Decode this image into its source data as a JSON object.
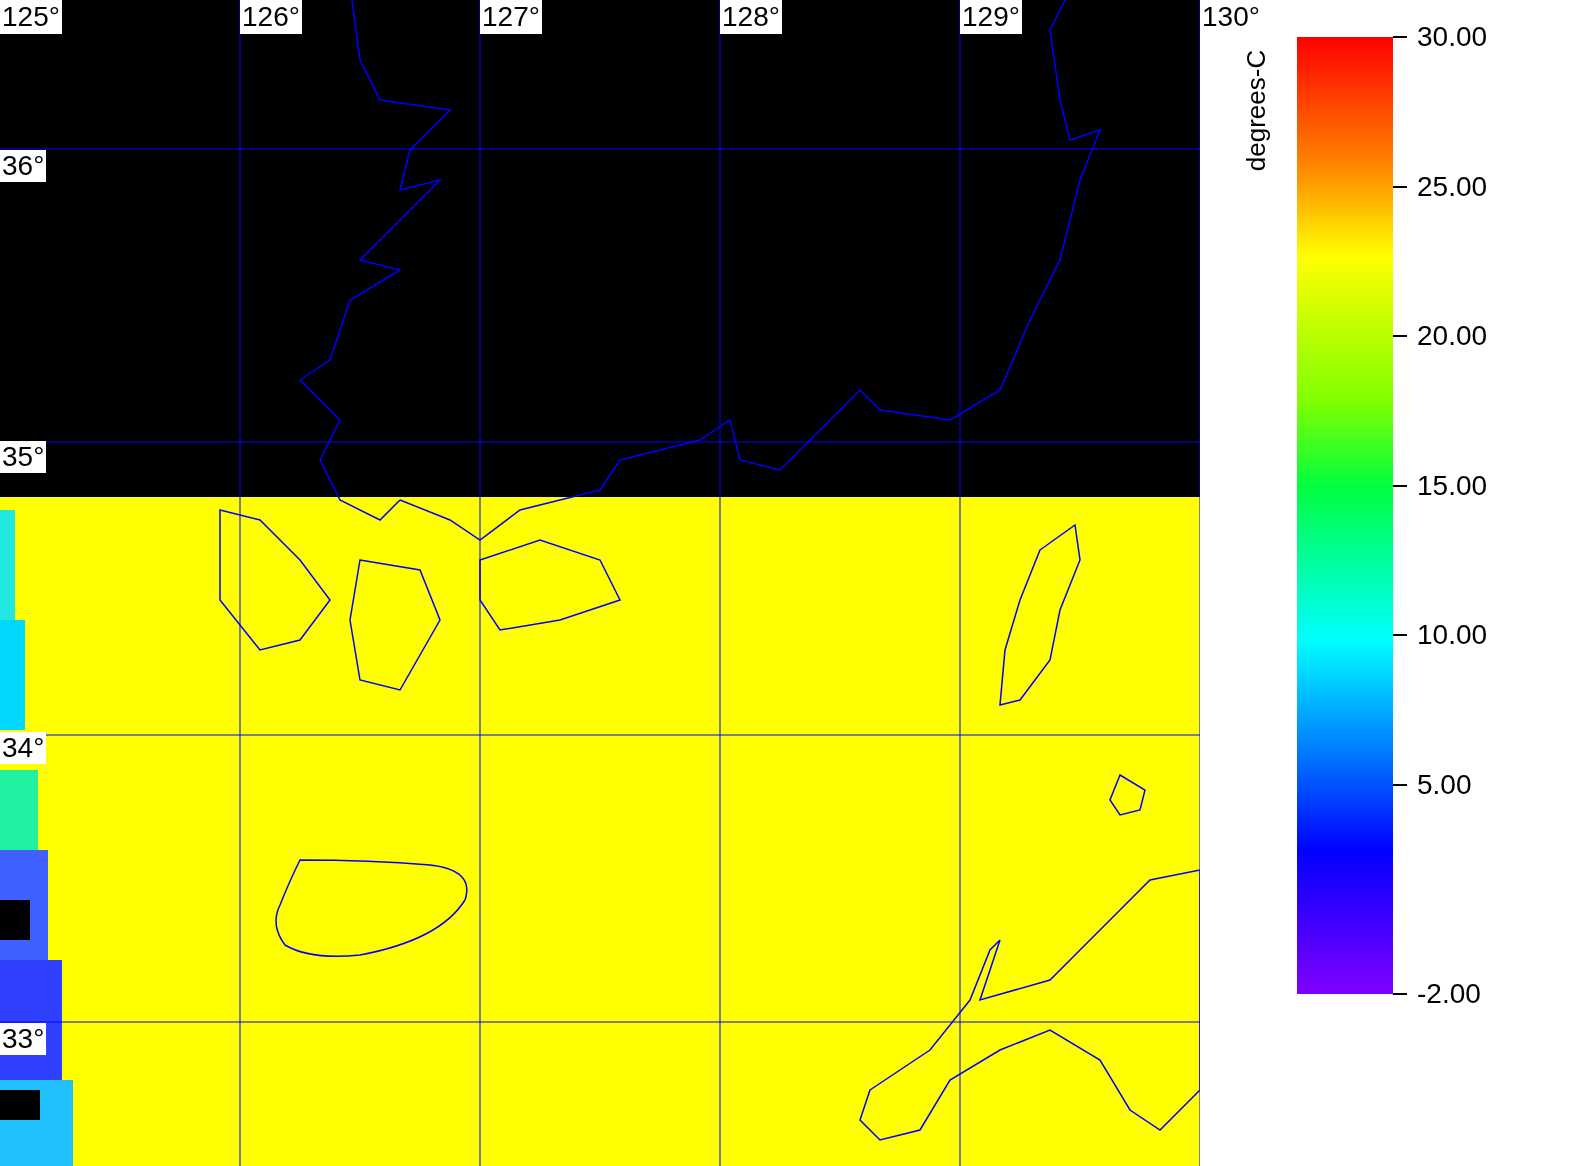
{
  "map": {
    "lon_labels": [
      "125°",
      "126°",
      "127°",
      "128°",
      "129°",
      "130°"
    ],
    "lat_labels": [
      "36°",
      "35°",
      "34°",
      "33°"
    ]
  },
  "colorbar": {
    "title": "degrees-C",
    "ticks": [
      "30.00",
      "25.00",
      "20.00",
      "15.00",
      "10.00",
      "5.00",
      "-2.00"
    ]
  }
}
